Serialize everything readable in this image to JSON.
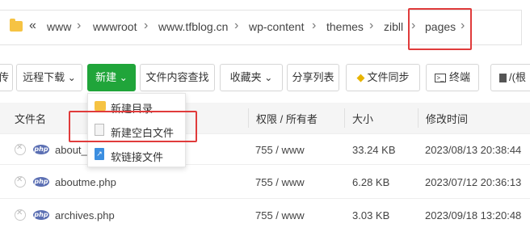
{
  "breadcrumb": {
    "items": [
      "www",
      "wwwroot",
      "www.tfblog.cn",
      "wp-content",
      "themes",
      "zibll",
      "pages"
    ],
    "back_glyph": "«",
    "separator_glyph": "›",
    "folder_icon": "folder-icon"
  },
  "toolbar": {
    "partial_left": "传",
    "remote_download": "远程下载",
    "new": "新建",
    "content_search": "文件内容查找",
    "favorites": "收藏夹",
    "share_list": "分享列表",
    "file_sync": "文件同步",
    "terminal": "终端",
    "root_partial": "/(根",
    "dropdown_glyph": "⌄"
  },
  "new_menu": {
    "items": [
      {
        "label": "新建目录",
        "icon": "folder-icon"
      },
      {
        "label": "新建空白文件",
        "icon": "file-icon"
      },
      {
        "label": "软链接文件",
        "icon": "symlink-icon"
      }
    ]
  },
  "table": {
    "headers": [
      "文件名",
      "权限 / 所有者",
      "大小",
      "修改时间"
    ],
    "rows": [
      {
        "name": "about_",
        "perm": "755 / www",
        "size": "33.24 KB",
        "mtime": "2023/08/13 20:38:44"
      },
      {
        "name": "aboutme.php",
        "perm": "755 / www",
        "size": "6.28 KB",
        "mtime": "2023/07/12 20:36:13"
      },
      {
        "name": "archives.php",
        "perm": "755 / www",
        "size": "3.03 KB",
        "mtime": "2023/09/18 13:20:48"
      }
    ],
    "file_type_badge": "php"
  },
  "colors": {
    "accent_green": "#20a53a",
    "highlight_red": "#e03b3b",
    "php_badge": "#5b6fb3",
    "folder_yellow": "#f6c343"
  }
}
